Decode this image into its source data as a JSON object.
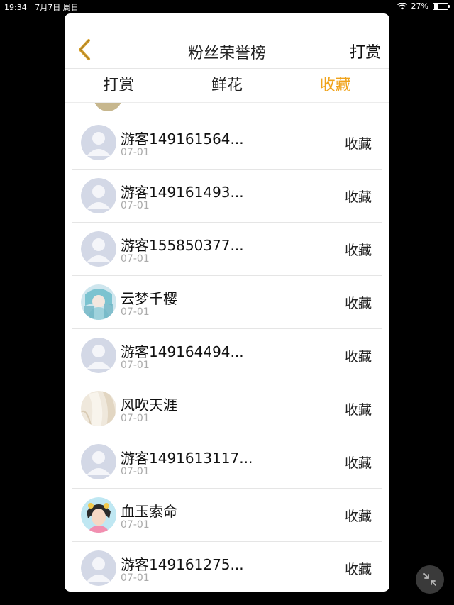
{
  "status": {
    "time": "19:34",
    "date": "7月7日 周日",
    "battery": "27%",
    "battery_level": 0.27
  },
  "header": {
    "title": "粉丝荣誉榜",
    "right_link": "打赏"
  },
  "tabs": [
    {
      "label": "打赏",
      "active": false
    },
    {
      "label": "鲜花",
      "active": false
    },
    {
      "label": "收藏",
      "active": true
    }
  ],
  "colors": {
    "accent": "#f0a31b",
    "divider": "#e5e5e5"
  },
  "rows": [
    {
      "name": "游客149161564...",
      "date": "07-01",
      "action": "收藏",
      "avatar": "default-avatar-icon"
    },
    {
      "name": "游客149161493...",
      "date": "07-01",
      "action": "收藏",
      "avatar": "default-avatar-icon"
    },
    {
      "name": "游客155850377...",
      "date": "07-01",
      "action": "收藏",
      "avatar": "default-avatar-icon"
    },
    {
      "name": "云梦千樱",
      "date": "07-01",
      "action": "收藏",
      "avatar": "anime-avatar"
    },
    {
      "name": "游客149164494...",
      "date": "07-01",
      "action": "收藏",
      "avatar": "default-avatar-icon"
    },
    {
      "name": "风吹天涯",
      "date": "07-01",
      "action": "收藏",
      "avatar": "fabric-avatar"
    },
    {
      "name": "游客1491613117...",
      "date": "07-01",
      "action": "收藏",
      "avatar": "default-avatar-icon"
    },
    {
      "name": "血玉索命",
      "date": "07-01",
      "action": "收藏",
      "avatar": "portrait-avatar"
    },
    {
      "name": "游客149161275...",
      "date": "07-01",
      "action": "收藏",
      "avatar": "default-avatar-icon"
    }
  ]
}
